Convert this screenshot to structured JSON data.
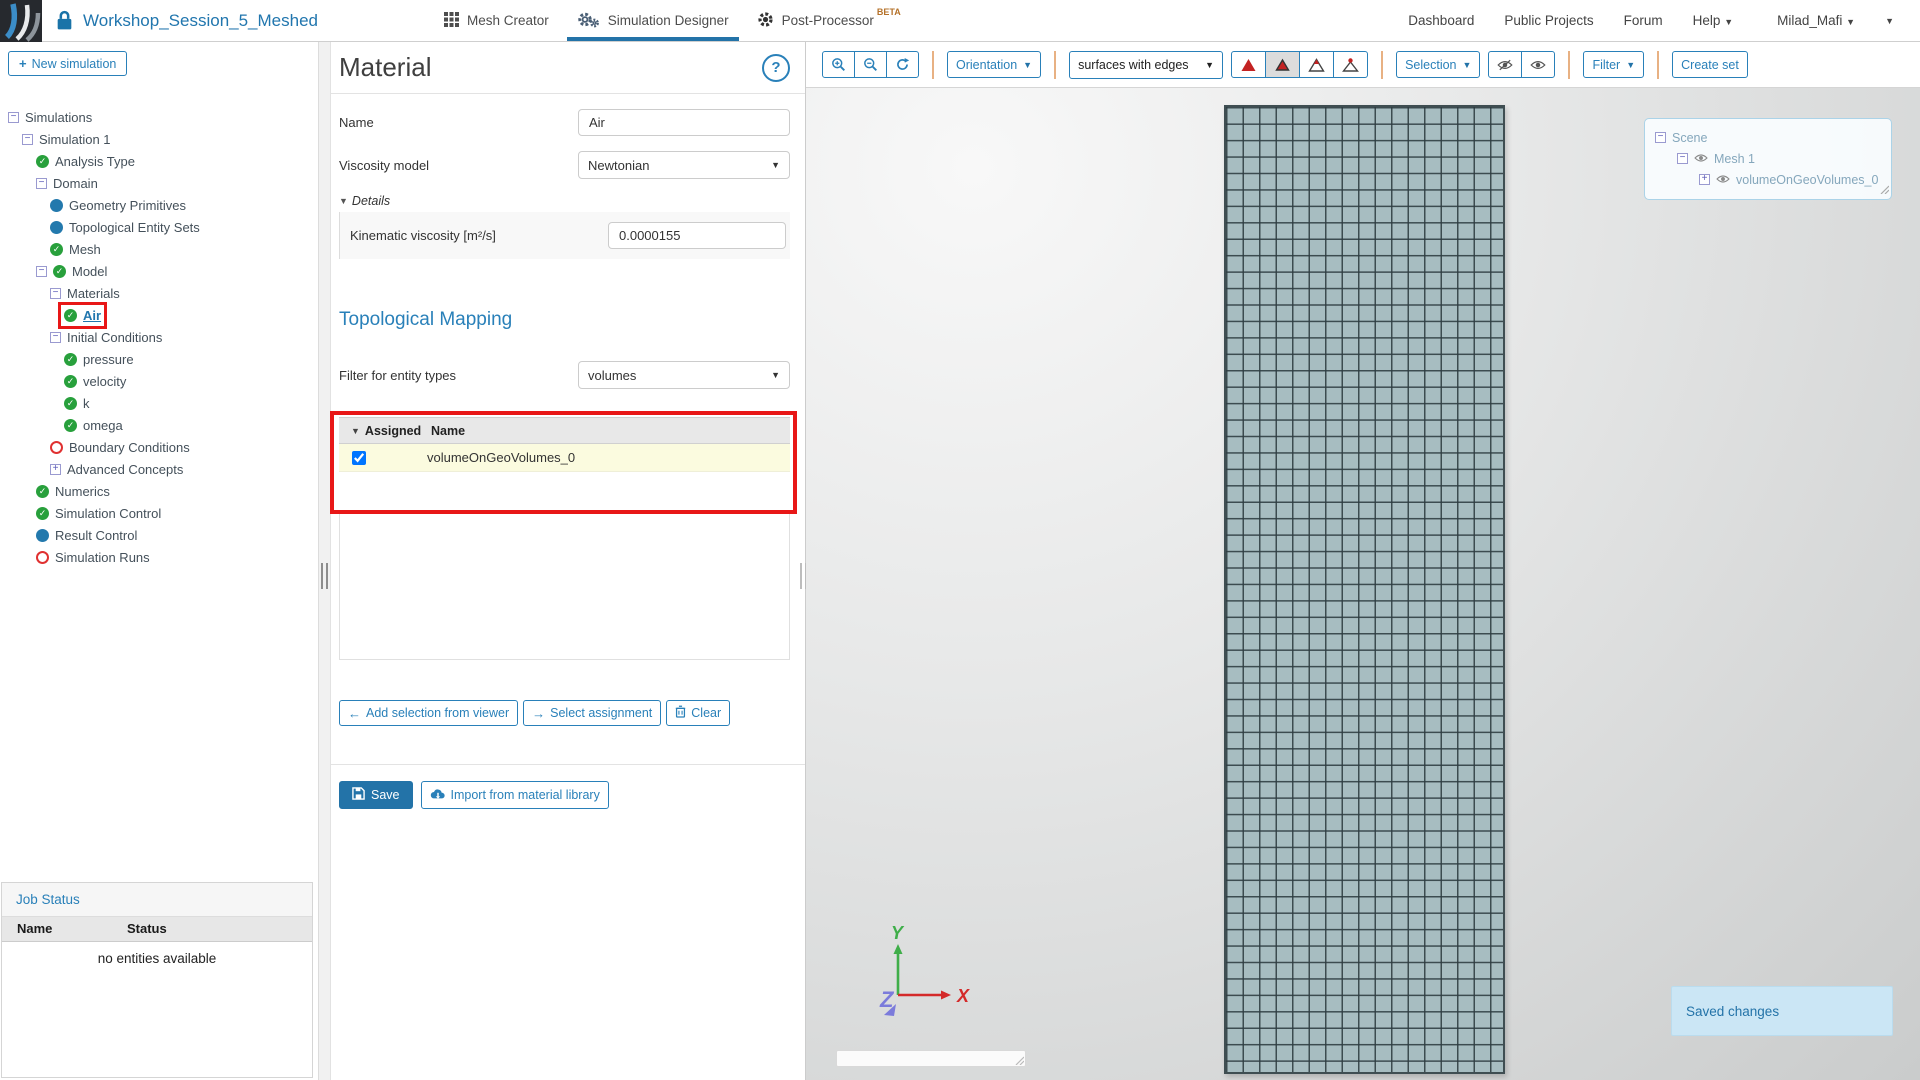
{
  "colors": {
    "accent": "#2980b9",
    "title_blue": "#2176ae",
    "annotation_red": "#e81717",
    "check_green": "#28a03c",
    "dot_blue": "#2379ad",
    "incomplete_red": "#e03131",
    "toast_bg": "#cbe6f5",
    "mesh_fill": "#a7bdc1",
    "mesh_line": "#3f4e52"
  },
  "header": {
    "project_title": "Workshop_Session_5_Meshed",
    "tabs": [
      {
        "label": "Mesh Creator",
        "icon": "grid-icon",
        "active": false,
        "badge": ""
      },
      {
        "label": "Simulation Designer",
        "icon": "gears-icon",
        "active": true,
        "badge": ""
      },
      {
        "label": "Post-Processor",
        "icon": "gear-dark-icon",
        "active": false,
        "badge": "BETA"
      }
    ],
    "nav_links": [
      "Dashboard",
      "Public Projects",
      "Forum"
    ],
    "help_label": "Help",
    "user_label": "Milad_Mafi"
  },
  "sidebar": {
    "new_simulation_label": "New simulation",
    "tree": [
      {
        "label": "Simulations",
        "indent": 0,
        "expander": "minus",
        "status": "none"
      },
      {
        "label": "Simulation 1",
        "indent": 1,
        "expander": "minus",
        "status": "none"
      },
      {
        "label": "Analysis Type",
        "indent": 2,
        "expander": "none",
        "status": "check"
      },
      {
        "label": "Domain",
        "indent": 2,
        "expander": "minus",
        "status": "none"
      },
      {
        "label": "Geometry Primitives",
        "indent": 3,
        "expander": "none",
        "status": "dot"
      },
      {
        "label": "Topological Entity Sets",
        "indent": 3,
        "expander": "none",
        "status": "dot"
      },
      {
        "label": "Mesh",
        "indent": 3,
        "expander": "none",
        "status": "check"
      },
      {
        "label": "Model",
        "indent": 2,
        "expander": "minus",
        "status": "check"
      },
      {
        "label": "Materials",
        "indent": 3,
        "expander": "minus",
        "status": "none"
      },
      {
        "label": "Air",
        "indent": 4,
        "expander": "none",
        "status": "check",
        "selected": true
      },
      {
        "label": "Initial Conditions",
        "indent": 3,
        "expander": "minus",
        "status": "none"
      },
      {
        "label": "pressure",
        "indent": 4,
        "expander": "none",
        "status": "check"
      },
      {
        "label": "velocity",
        "indent": 4,
        "expander": "none",
        "status": "check"
      },
      {
        "label": "k",
        "indent": 4,
        "expander": "none",
        "status": "check"
      },
      {
        "label": "omega",
        "indent": 4,
        "expander": "none",
        "status": "check"
      },
      {
        "label": "Boundary Conditions",
        "indent": 3,
        "expander": "none",
        "status": "open"
      },
      {
        "label": "Advanced Concepts",
        "indent": 3,
        "expander": "plus",
        "status": "none"
      },
      {
        "label": "Numerics",
        "indent": 2,
        "expander": "none",
        "status": "check"
      },
      {
        "label": "Simulation Control",
        "indent": 2,
        "expander": "none",
        "status": "check"
      },
      {
        "label": "Result Control",
        "indent": 2,
        "expander": "none",
        "status": "dot"
      },
      {
        "label": "Simulation Runs",
        "indent": 2,
        "expander": "none",
        "status": "open"
      }
    ],
    "job_status": {
      "title": "Job Status",
      "name_header": "Name",
      "status_header": "Status",
      "empty_text": "no entities available"
    }
  },
  "material_panel": {
    "title": "Material",
    "help_label": "?",
    "name_label": "Name",
    "name_value": "Air",
    "viscosity_label": "Viscosity model",
    "viscosity_value": "Newtonian",
    "details_label": "Details",
    "kinematic_label": "Kinematic viscosity [m²/s]",
    "kinematic_value": "0.0000155",
    "topological_title": "Topological Mapping",
    "filter_label": "Filter for entity types",
    "filter_value": "volumes",
    "table": {
      "assigned_header": "Assigned",
      "name_header": "Name",
      "rows": [
        {
          "assigned": true,
          "name": "volumeOnGeoVolumes_0"
        }
      ]
    },
    "buttons": {
      "add_selection": "Add selection from viewer",
      "select_assignment": "Select assignment",
      "clear": "Clear",
      "save": "Save",
      "import_library": "Import from material library"
    }
  },
  "viewer": {
    "toolbar": {
      "orientation_label": "Orientation",
      "render_mode_value": "surfaces with edges",
      "selection_label": "Selection",
      "filter_label": "Filter",
      "create_set_label": "Create set"
    },
    "scene_tree": [
      {
        "label": "Scene",
        "expander": "minus",
        "eye": false,
        "indent": 0
      },
      {
        "label": "Mesh 1",
        "expander": "minus",
        "eye": true,
        "indent": 1
      },
      {
        "label": "volumeOnGeoVolumes_0",
        "expander": "plus",
        "eye": true,
        "indent": 2
      }
    ],
    "axes": {
      "x": "X",
      "y": "Y",
      "z": "Z"
    },
    "toast_text": "Saved changes",
    "mesh": {
      "name": "volumeOnGeoVolumes_0",
      "columns": 17,
      "rows": 59
    }
  }
}
